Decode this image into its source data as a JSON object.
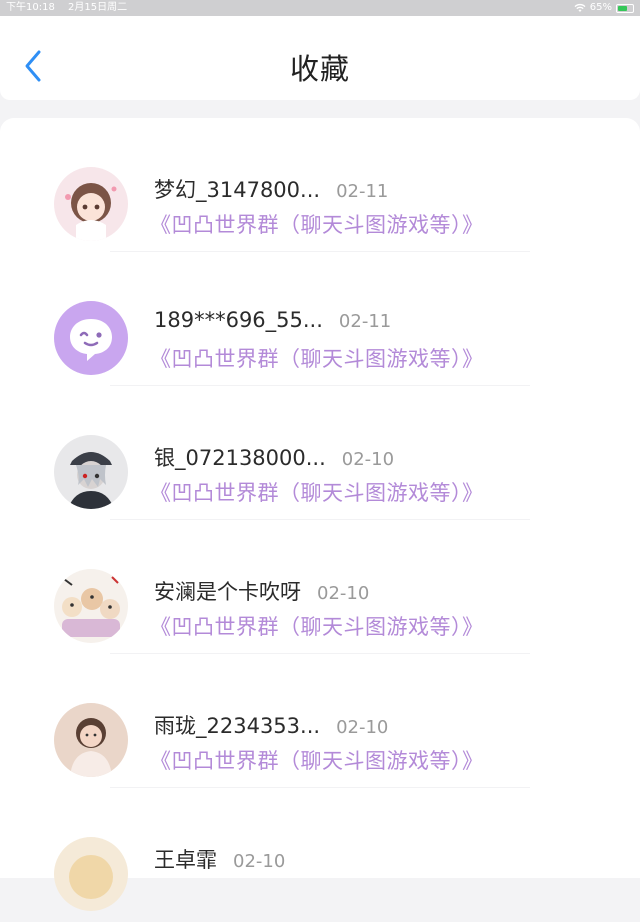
{
  "status_bar": {
    "time": "下午10:18",
    "date": "2月15日周二",
    "battery": "65%",
    "battery_level": 0.65
  },
  "header": {
    "title": "收藏",
    "back_icon": "chevron-left-icon"
  },
  "colors": {
    "accent": "#2f8ff5",
    "group_text": "#b38ad8",
    "date_text": "#9a9a9a"
  },
  "favorites": [
    {
      "username": "梦幻_3147800...",
      "date": "02-11",
      "group": "《凹凸世界群（聊天斗图游戏等）》",
      "avatar": "anime-girl-avatar"
    },
    {
      "username": "189***696_55...",
      "date": "02-11",
      "group": "《凹凸世界群（聊天斗图游戏等）》",
      "avatar": "chat-bubble-avatar"
    },
    {
      "username": "银_072138000...",
      "date": "02-10",
      "group": "《凹凸世界群（聊天斗图游戏等）》",
      "avatar": "anime-boy-avatar"
    },
    {
      "username": "安澜是个卡吹呀",
      "date": "02-10",
      "group": "《凹凸世界群（聊天斗图游戏等）》",
      "avatar": "sticker-collage-avatar"
    },
    {
      "username": "雨珑_2234353...",
      "date": "02-10",
      "group": "《凹凸世界群（聊天斗图游戏等）》",
      "avatar": "photo-girl-avatar"
    },
    {
      "username": "王卓霏",
      "date": "02-10",
      "group": "",
      "avatar": "partial-avatar"
    }
  ]
}
